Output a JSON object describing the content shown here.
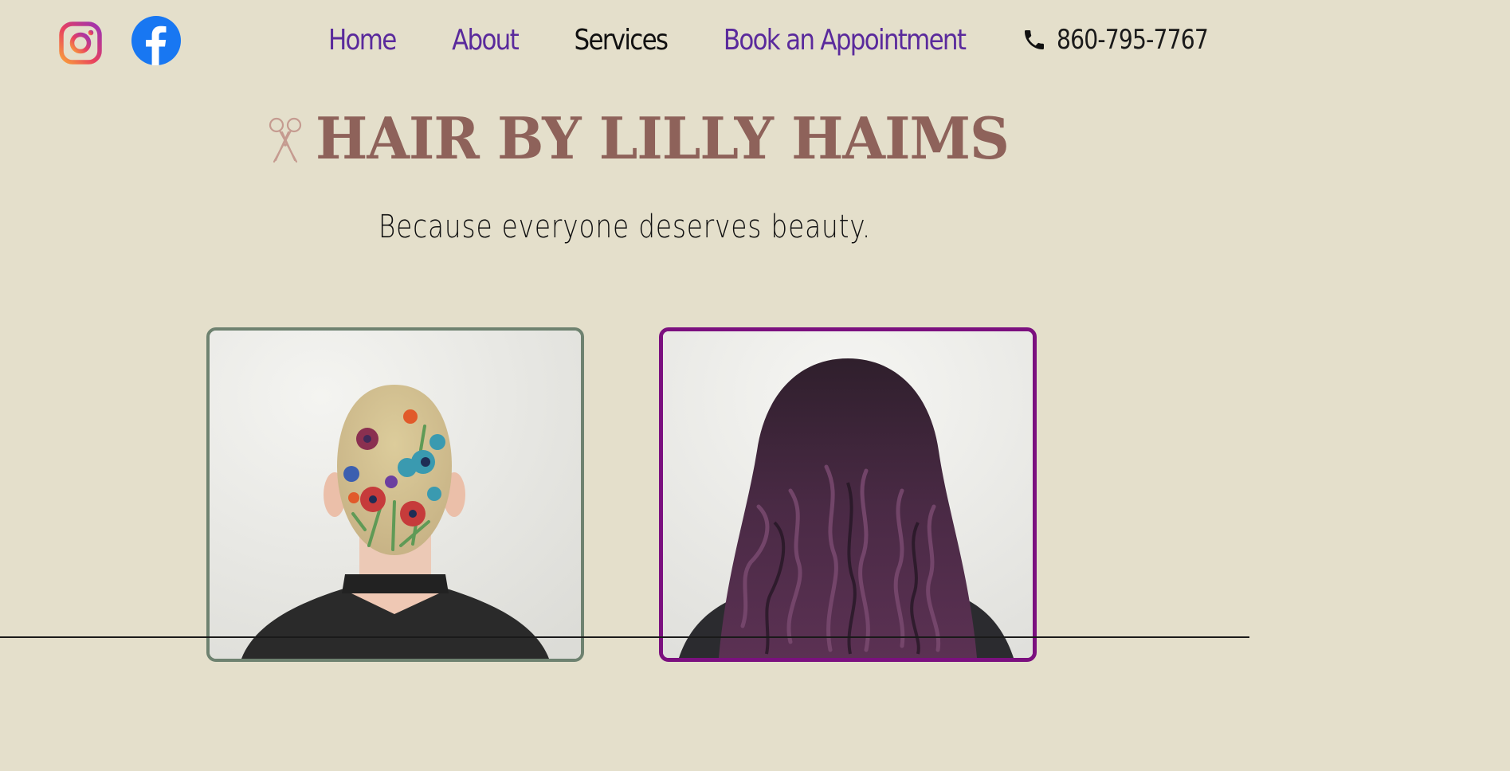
{
  "social": {
    "icons": [
      "instagram-icon",
      "facebook-icon"
    ]
  },
  "nav": {
    "items": [
      {
        "label": "Home"
      },
      {
        "label": "About"
      },
      {
        "label": "Services"
      },
      {
        "label": "Book an Appointment"
      }
    ],
    "active": "Services"
  },
  "contact": {
    "icon": "phone-icon",
    "phone": "860-795-7767"
  },
  "brand": {
    "icon": "scissors-icon",
    "title": "HAIR BY LILLY HAIMS"
  },
  "tagline": "Because everyone deserves beauty.",
  "gallery": {
    "items": [
      {
        "subject": "shaved head with painted flower design"
      },
      {
        "subject": "long wavy plum-colored hair"
      }
    ]
  },
  "colors": {
    "background": "#e4dfcb",
    "nav_link": "#5a2a9c",
    "nav_active": "#111111",
    "brand_title": "#8e625a",
    "card_left_border": "#6e8270",
    "card_right_border": "#7b107f",
    "facebook_blue": "#1877f2"
  }
}
